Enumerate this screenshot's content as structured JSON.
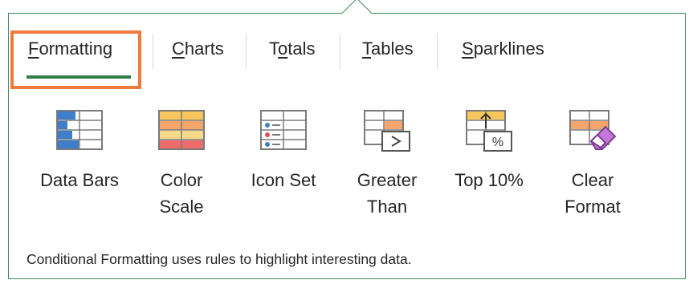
{
  "tabs": [
    {
      "label": "Formatting",
      "access_key": "F",
      "rest": "ormatting",
      "selected": true
    },
    {
      "label": "Charts",
      "access_key": "C",
      "rest": "harts",
      "selected": false
    },
    {
      "pre": "T",
      "access_key": "o",
      "rest": "tals",
      "label": "Totals",
      "selected": false
    },
    {
      "label": "Tables",
      "access_key": "T",
      "rest": "ables",
      "selected": false
    },
    {
      "label": "Sparklines",
      "access_key": "S",
      "rest": "parklines",
      "selected": false
    }
  ],
  "items": [
    {
      "label_line1": "Data Bars",
      "label_line2": "",
      "icon": "data-bars-icon"
    },
    {
      "label_line1": "Color",
      "label_line2": "Scale",
      "icon": "color-scale-icon"
    },
    {
      "label_line1": "Icon Set",
      "label_line2": "",
      "icon": "icon-set-icon"
    },
    {
      "label_line1": "Greater",
      "label_line2": "Than",
      "icon": "greater-than-icon"
    },
    {
      "label_line1": "Top 10%",
      "label_line2": "",
      "icon": "top-10-percent-icon"
    },
    {
      "label_line1": "Clear",
      "label_line2": "Format",
      "icon": "clear-format-icon"
    }
  ],
  "description": "Conditional Formatting uses rules to highlight interesting data.",
  "colors": {
    "border": "#3b8a57",
    "highlight": "#ef7a3b",
    "selected_underline": "#2e7d46"
  }
}
